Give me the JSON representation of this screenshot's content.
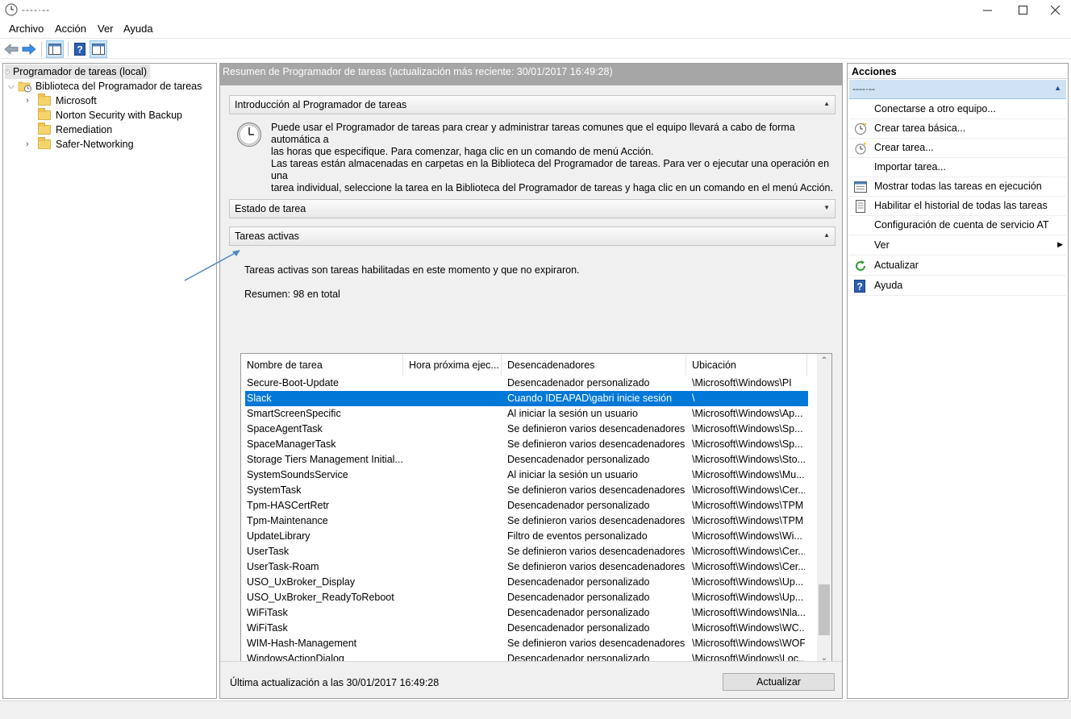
{
  "window": {
    "title": "----·--"
  },
  "menu": {
    "items": [
      "Archivo",
      "Acción",
      "Ver",
      "Ayuda"
    ]
  },
  "toolbar": {
    "icons": [
      "back-arrow-icon",
      "forward-arrow-icon",
      "show-hide-tree-icon",
      "help-icon",
      "show-hide-actions-icon"
    ]
  },
  "tree": {
    "root": "Programador de tareas (local)",
    "library": "Biblioteca del Programador de tareas",
    "children": [
      "Microsoft",
      "Norton Security with Backup",
      "Remediation",
      "Safer-Networking"
    ]
  },
  "middle": {
    "header": "Resumen de Programador de tareas (actualización más reciente: 30/01/2017 16:49:28)",
    "intro": {
      "title": "Introducción al Programador de tareas",
      "p1a": "Puede usar el Programador de tareas para crear y administrar tareas comunes que el equipo llevará a cabo de forma automática a",
      "p1b": "las horas que especifique. Para comenzar, haga clic en un comando de menú Acción.",
      "p2a": "Las tareas están almacenadas en carpetas en la Biblioteca del Programador de tareas. Para ver o ejecutar una operación en una",
      "p2b": "tarea individual, seleccione la tarea en la Biblioteca del Programador de tareas y haga clic en un comando en el menú Acción."
    },
    "status": {
      "title": "Estado de tarea"
    },
    "active": {
      "title": "Tareas activas",
      "description": "Tareas activas son tareas habilitadas en este momento y que no expiraron.",
      "summary": "Resumen: 98 en total"
    },
    "table": {
      "columns": [
        "Nombre de tarea",
        "Hora próxima ejec...",
        "Desencadenadores",
        "Ubicación"
      ],
      "rows": [
        [
          "Secure-Boot-Update",
          "",
          "Desencadenador personalizado",
          "\\Microsoft\\Windows\\PI"
        ],
        [
          "Slack",
          "",
          "Cuando IDEAPAD\\gabri inicie sesión",
          "\\"
        ],
        [
          "SmartScreenSpecific",
          "",
          "Al iniciar la sesión un usuario",
          "\\Microsoft\\Windows\\Ap..."
        ],
        [
          "SpaceAgentTask",
          "",
          "Se definieron varios desencadenadores",
          "\\Microsoft\\Windows\\Sp..."
        ],
        [
          "SpaceManagerTask",
          "",
          "Se definieron varios desencadenadores",
          "\\Microsoft\\Windows\\Sp..."
        ],
        [
          "Storage Tiers Management Initial...",
          "",
          "Desencadenador personalizado",
          "\\Microsoft\\Windows\\Sto..."
        ],
        [
          "SystemSoundsService",
          "",
          "Al iniciar la sesión un usuario",
          "\\Microsoft\\Windows\\Mu..."
        ],
        [
          "SystemTask",
          "",
          "Se definieron varios desencadenadores",
          "\\Microsoft\\Windows\\Cer..."
        ],
        [
          "Tpm-HASCertRetr",
          "",
          "Desencadenador personalizado",
          "\\Microsoft\\Windows\\TPM"
        ],
        [
          "Tpm-Maintenance",
          "",
          "Se definieron varios desencadenadores",
          "\\Microsoft\\Windows\\TPM"
        ],
        [
          "UpdateLibrary",
          "",
          "Filtro de eventos personalizado",
          "\\Microsoft\\Windows\\Wi..."
        ],
        [
          "UserTask",
          "",
          "Se definieron varios desencadenadores",
          "\\Microsoft\\Windows\\Cer..."
        ],
        [
          "UserTask-Roam",
          "",
          "Se definieron varios desencadenadores",
          "\\Microsoft\\Windows\\Cer..."
        ],
        [
          "USO_UxBroker_Display",
          "",
          "Desencadenador personalizado",
          "\\Microsoft\\Windows\\Up..."
        ],
        [
          "USO_UxBroker_ReadyToReboot",
          "",
          "Desencadenador personalizado",
          "\\Microsoft\\Windows\\Up..."
        ],
        [
          "WiFiTask",
          "",
          "Desencadenador personalizado",
          "\\Microsoft\\Windows\\Nla..."
        ],
        [
          "WiFiTask",
          "",
          "Desencadenador personalizado",
          "\\Microsoft\\Windows\\WC..."
        ],
        [
          "WIM-Hash-Management",
          "",
          "Se definieron varios desencadenadores",
          "\\Microsoft\\Windows\\WOF"
        ],
        [
          "WindowsActionDialog",
          "",
          "Desencadenador personalizado",
          "\\Microsoft\\Windows\\Loc..."
        ]
      ],
      "selected_row": 1
    },
    "footer": {
      "last_update": "Última actualización a las 30/01/2017 16:49:28",
      "refresh_label": "Actualizar"
    }
  },
  "actions": {
    "title": "Acciones",
    "subheader": "----·--",
    "items": [
      {
        "label": "Conectarse a otro equipo...",
        "icon": ""
      },
      {
        "label": "Crear tarea básica...",
        "icon": "create-basic-task-icon"
      },
      {
        "label": "Crear tarea...",
        "icon": "create-task-icon"
      },
      {
        "label": "Importar tarea...",
        "icon": ""
      },
      {
        "label": "Mostrar todas las tareas en ejecución",
        "icon": "running-tasks-icon"
      },
      {
        "label": "Habilitar el historial de todas las tareas",
        "icon": "history-icon"
      },
      {
        "label": "Configuración de cuenta de servicio AT",
        "icon": ""
      },
      {
        "label": "Ver",
        "icon": ""
      },
      {
        "label": "Actualizar",
        "icon": "refresh-icon"
      },
      {
        "label": "Ayuda",
        "icon": "help-icon"
      }
    ]
  }
}
